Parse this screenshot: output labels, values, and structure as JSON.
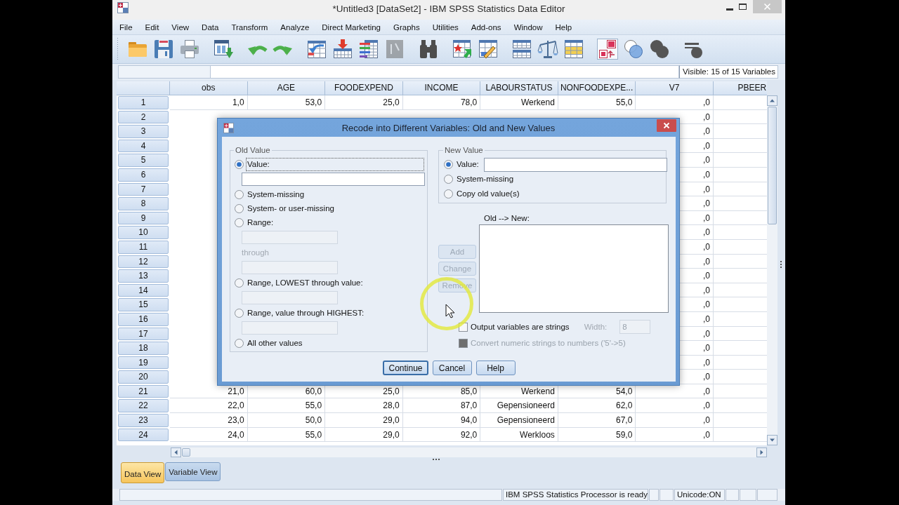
{
  "window": {
    "title": "*Untitled3 [DataSet2] - IBM SPSS Statistics Data Editor"
  },
  "menu": [
    "File",
    "Edit",
    "View",
    "Data",
    "Transform",
    "Analyze",
    "Direct Marketing",
    "Graphs",
    "Utilities",
    "Add-ons",
    "Window",
    "Help"
  ],
  "toolbar": [
    [
      {
        "pressed": false,
        "disabled": false
      },
      {
        "pressed": false,
        "disabled": false
      },
      {
        "pressed": false,
        "disabled": false
      }
    ],
    [
      {
        "pressed": false,
        "disabled": false
      }
    ],
    [
      {
        "pressed": false,
        "disabled": false
      },
      {
        "pressed": false,
        "disabled": false
      }
    ],
    [
      {
        "pressed": false,
        "disabled": false
      },
      {
        "pressed": false,
        "disabled": false
      },
      {
        "pressed": false,
        "disabled": false
      },
      {
        "pressed": false,
        "disabled": true
      }
    ],
    [
      {
        "pressed": false,
        "disabled": false
      }
    ],
    [
      {
        "pressed": false,
        "disabled": false
      },
      {
        "pressed": false,
        "disabled": false
      }
    ],
    [
      {
        "pressed": false,
        "disabled": false
      },
      {
        "pressed": false,
        "disabled": false
      },
      {
        "pressed": false,
        "disabled": false
      }
    ],
    [
      {
        "pressed": true,
        "disabled": false
      },
      {
        "pressed": false,
        "disabled": false
      },
      {
        "pressed": false,
        "disabled": false
      }
    ],
    [
      {
        "pressed": false,
        "disabled": false
      }
    ]
  ],
  "cell_editor": {
    "variable_count": "Visible: 15 of 15 Variables"
  },
  "grid": {
    "columns": [
      "obs",
      "AGE",
      "FOODEXPEND",
      "INCOME",
      "LABOURSTATUS",
      "NONFOODEXPE...",
      "V7",
      "PBEER"
    ],
    "rows": [
      {
        "number": "1",
        "cells": [
          "1,0",
          "53,0",
          "25,0",
          "78,0",
          "Werkend",
          "55,0",
          ",0"
        ]
      },
      {
        "number": "2",
        "cells": [
          null,
          null,
          null,
          null,
          null,
          null,
          ",0"
        ]
      },
      {
        "number": "3",
        "cells": [
          null,
          null,
          null,
          null,
          null,
          null,
          ",0"
        ]
      },
      {
        "number": "4",
        "cells": [
          null,
          null,
          null,
          null,
          null,
          null,
          ",0"
        ]
      },
      {
        "number": "5",
        "cells": [
          null,
          null,
          null,
          null,
          null,
          null,
          ",0"
        ]
      },
      {
        "number": "6",
        "cells": [
          null,
          null,
          null,
          null,
          null,
          null,
          ",0"
        ]
      },
      {
        "number": "7",
        "cells": [
          null,
          null,
          null,
          null,
          null,
          null,
          ",0"
        ]
      },
      {
        "number": "8",
        "cells": [
          null,
          null,
          null,
          null,
          null,
          null,
          ",0"
        ]
      },
      {
        "number": "9",
        "cells": [
          null,
          null,
          null,
          null,
          null,
          null,
          ",0"
        ]
      },
      {
        "number": "10",
        "cells": [
          null,
          null,
          null,
          null,
          null,
          null,
          ",0"
        ]
      },
      {
        "number": "11",
        "cells": [
          null,
          null,
          null,
          null,
          null,
          null,
          ",0"
        ]
      },
      {
        "number": "12",
        "cells": [
          null,
          null,
          null,
          null,
          null,
          null,
          ",0"
        ]
      },
      {
        "number": "13",
        "cells": [
          null,
          null,
          null,
          null,
          null,
          null,
          ",0"
        ]
      },
      {
        "number": "14",
        "cells": [
          null,
          null,
          null,
          null,
          null,
          null,
          ",0"
        ]
      },
      {
        "number": "15",
        "cells": [
          null,
          null,
          null,
          null,
          null,
          null,
          ",0"
        ]
      },
      {
        "number": "16",
        "cells": [
          null,
          null,
          null,
          null,
          null,
          null,
          ",0"
        ]
      },
      {
        "number": "17",
        "cells": [
          null,
          null,
          null,
          null,
          null,
          null,
          ",0"
        ]
      },
      {
        "number": "18",
        "cells": [
          null,
          null,
          null,
          null,
          null,
          null,
          ",0"
        ]
      },
      {
        "number": "19",
        "cells": [
          null,
          null,
          null,
          null,
          null,
          null,
          ",0"
        ]
      },
      {
        "number": "20",
        "cells": [
          null,
          null,
          null,
          null,
          null,
          null,
          ",0"
        ]
      },
      {
        "number": "21",
        "cells": [
          "21,0",
          "60,0",
          "25,0",
          "85,0",
          "Werkend",
          "54,0",
          ",0"
        ]
      },
      {
        "number": "22",
        "cells": [
          "22,0",
          "55,0",
          "28,0",
          "87,0",
          "Gepensioneerd",
          "62,0",
          ",0"
        ]
      },
      {
        "number": "23",
        "cells": [
          "23,0",
          "50,0",
          "29,0",
          "94,0",
          "Gepensioneerd",
          "67,0",
          ",0"
        ]
      },
      {
        "number": "24",
        "cells": [
          "24,0",
          "55,0",
          "29,0",
          "92,0",
          "Werkloos",
          "59,0",
          ",0"
        ]
      }
    ]
  },
  "view_tabs": [
    {
      "label": "Data View",
      "selected": true
    },
    {
      "label": "Variable View",
      "selected": false
    }
  ],
  "status_bar": {
    "message": "IBM SPSS Statistics Processor is ready",
    "encoding": "Unicode:ON"
  },
  "dialog": {
    "title": "Recode into Different Variables: Old and New Values",
    "old_value": {
      "title": "Old Value",
      "options": [
        {
          "kind": "value",
          "label": "Value:",
          "selected": true,
          "focused": true
        },
        {
          "kind": "plain",
          "label": "System-missing",
          "selected": false,
          "focused": false
        },
        {
          "kind": "plain",
          "label": "System- or user-missing",
          "selected": false,
          "focused": false
        },
        {
          "kind": "range",
          "label": "Range:",
          "selected": false,
          "focused": false,
          "between": "through"
        },
        {
          "kind": "bounded",
          "label": "Range, LOWEST through value:",
          "selected": false,
          "focused": false
        },
        {
          "kind": "bounded",
          "label": "Range, value through HIGHEST:",
          "selected": false,
          "focused": false
        },
        {
          "kind": "plain",
          "label": "All other values",
          "selected": false,
          "focused": false
        }
      ]
    },
    "new_value": {
      "title": "New Value",
      "options": [
        {
          "kind": "value",
          "label": "Value:",
          "selected": true
        },
        {
          "kind": "plain",
          "label": "System-missing",
          "selected": false
        },
        {
          "kind": "plain",
          "label": "Copy old value(s)",
          "selected": false
        }
      ]
    },
    "mapping_list": {
      "label": "Old --> New:"
    },
    "list_buttons": [
      {
        "label": "Add",
        "disabled": true
      },
      {
        "label": "Change",
        "disabled": true
      },
      {
        "label": "Remove",
        "disabled": true
      }
    ],
    "output_strings": {
      "label": "Output variables are strings",
      "checked": false,
      "width_label": "Width:",
      "width_value": "8"
    },
    "convert_numeric": {
      "label": "Convert numeric strings to numbers ('5'->5)",
      "checked": false,
      "disabled": true
    },
    "buttons": [
      {
        "label": "Continue",
        "default": true
      },
      {
        "label": "Cancel",
        "default": false
      },
      {
        "label": "Help",
        "default": false
      }
    ]
  }
}
